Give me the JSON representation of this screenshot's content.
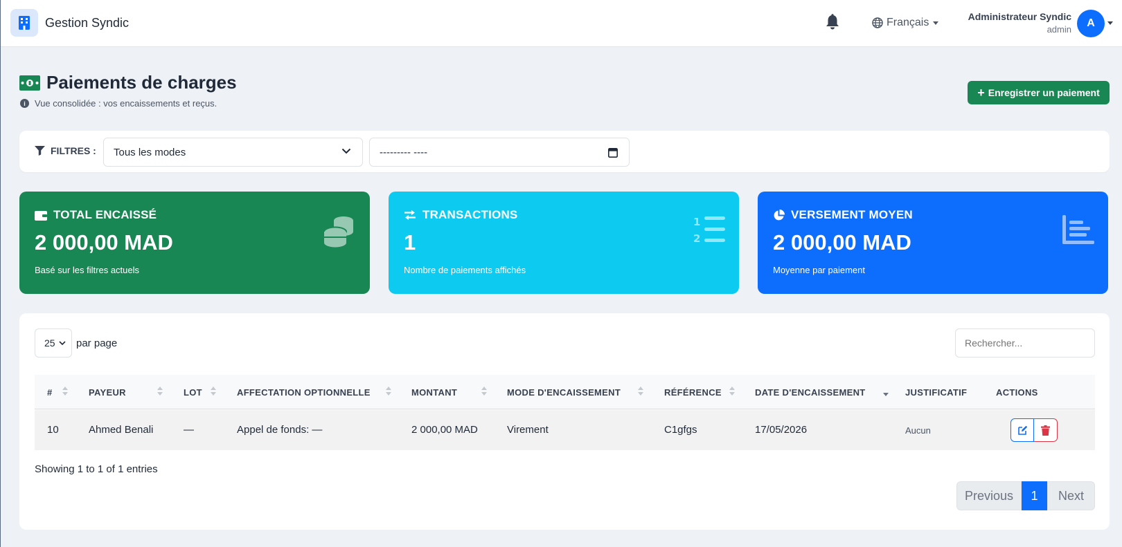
{
  "app": {
    "name": "Gestion Syndic"
  },
  "nav": {
    "language": "Français",
    "user_name": "Administrateur Syndic",
    "user_role": "admin",
    "avatar_letter": "A"
  },
  "page": {
    "title": "Paiements de charges",
    "subtitle": "Vue consolidée : vos encaissements et reçus.",
    "add_button": "Enregistrer un paiement"
  },
  "filters": {
    "label": "FILTRES :",
    "mode_selected": "Tous les modes",
    "date_value": "--------- ----"
  },
  "stats": [
    {
      "title": "TOTAL ENCAISSÉ",
      "value": "2 000,00 MAD",
      "note": "Basé sur les filtres actuels",
      "color": "#198754"
    },
    {
      "title": "TRANSACTIONS",
      "value": "1",
      "note": "Nombre de paiements affichés",
      "color": "#0dcaf0"
    },
    {
      "title": "VERSEMENT MOYEN",
      "value": "2 000,00 MAD",
      "note": "Moyenne par paiement",
      "color": "#0d6efd"
    }
  ],
  "table": {
    "per_page": "25",
    "per_page_label": "par page",
    "search_placeholder": "Rechercher...",
    "columns": [
      "#",
      "PAYEUR",
      "LOT",
      "AFFECTATION OPTIONNELLE",
      "MONTANT",
      "MODE D'ENCAISSEMENT",
      "RÉFÉRENCE",
      "DATE D'ENCAISSEMENT",
      "JUSTIFICATIF",
      "ACTIONS"
    ],
    "rows": [
      {
        "id": "10",
        "payer": "Ahmed Benali",
        "lot": "—",
        "affectation": "Appel de fonds: —",
        "amount": "2 000,00 MAD",
        "mode": "Virement",
        "reference": "C1gfgs",
        "date": "17/05/2026",
        "justificatif": "Aucun"
      }
    ],
    "showing": "Showing 1 to 1 of 1 entries",
    "pagination": {
      "previous": "Previous",
      "current": "1",
      "next": "Next"
    }
  },
  "colors": {
    "primary": "#0d6efd",
    "success": "#198754",
    "info": "#0dcaf0",
    "danger": "#dc3545"
  }
}
